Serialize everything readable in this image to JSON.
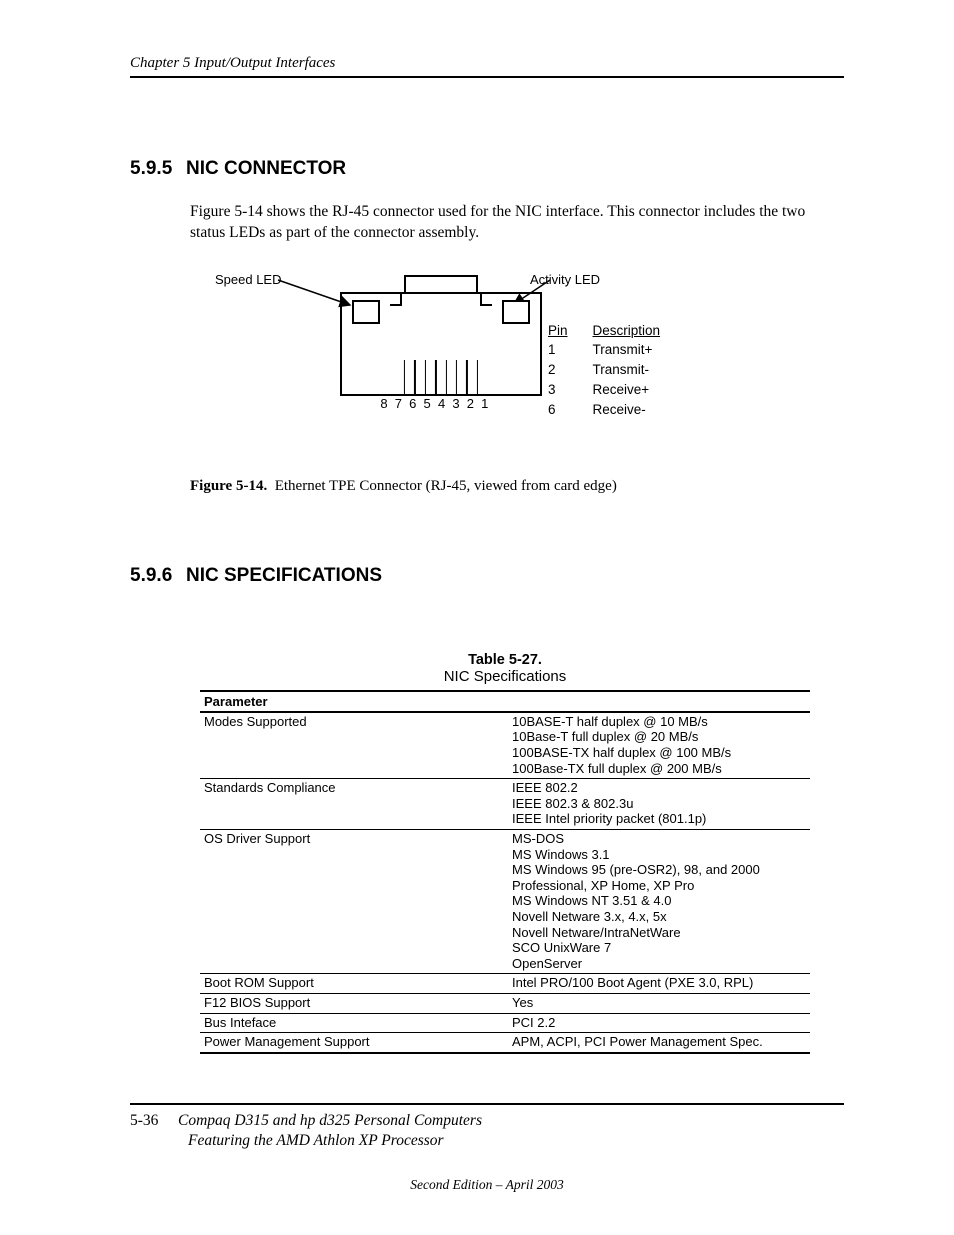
{
  "chapter_header": "Chapter 5  Input/Output Interfaces",
  "section595": {
    "num": "5.9.5",
    "title": "NIC CONNECTOR",
    "body": "Figure 5-14 shows the RJ-45 connector used for the NIC interface. This connector includes the two status LEDs as part of the connector assembly."
  },
  "figure": {
    "speed_label": "Speed LED",
    "activity_label": "Activity LED",
    "pin_numbers": [
      "8",
      "7",
      "6",
      "5",
      "4",
      "3",
      "2",
      "1"
    ],
    "pin_table": {
      "head_pin": "Pin",
      "head_desc": "Description",
      "rows": [
        {
          "pin": "1",
          "desc": "Transmit+"
        },
        {
          "pin": "2",
          "desc": "Transmit-"
        },
        {
          "pin": "3",
          "desc": "Receive+"
        },
        {
          "pin": "6",
          "desc": "Receive-"
        }
      ]
    },
    "caption_label": "Figure 5-14.",
    "caption_text": "Ethernet TPE Connector (RJ-45, viewed from card edge)"
  },
  "section596": {
    "num": "5.9.6",
    "title": "NIC SPECIFICATIONS"
  },
  "table": {
    "number": "Table 5-27.",
    "name": "NIC Specifications",
    "param_head": "Parameter",
    "rows": [
      {
        "param": "Modes Supported",
        "value": "10BASE-T half duplex @ 10 MB/s\n10Base-T full duplex @ 20 MB/s\n100BASE-TX half duplex @ 100 MB/s\n100Base-TX full duplex @ 200 MB/s"
      },
      {
        "param": "Standards Compliance",
        "value": "IEEE 802.2\nIEEE 802.3 & 802.3u\nIEEE Intel priority packet (801.1p)"
      },
      {
        "param": "OS Driver Support",
        "value": "MS-DOS\nMS Windows 3.1\nMS Windows 95 (pre-OSR2), 98, and 2000\nProfessional, XP Home, XP Pro\nMS Windows NT 3.51 & 4.0\nNovell Netware 3.x, 4.x, 5x\nNovell Netware/IntraNetWare\nSCO UnixWare 7\nOpenServer"
      },
      {
        "param": "Boot ROM Support",
        "value": "Intel PRO/100 Boot Agent (PXE 3.0, RPL)"
      },
      {
        "param": "F12 BIOS Support",
        "value": "Yes"
      },
      {
        "param": "Bus Inteface",
        "value": "PCI 2.2"
      },
      {
        "param": "Power Management Support",
        "value": "APM, ACPI, PCI Power Management Spec."
      }
    ]
  },
  "footer": {
    "page_num": "5-36",
    "title_line": "Compaq D315 and hp d325 Personal Computers",
    "sub_line": "Featuring the AMD Athlon XP Processor",
    "edition": "Second Edition – April 2003"
  }
}
